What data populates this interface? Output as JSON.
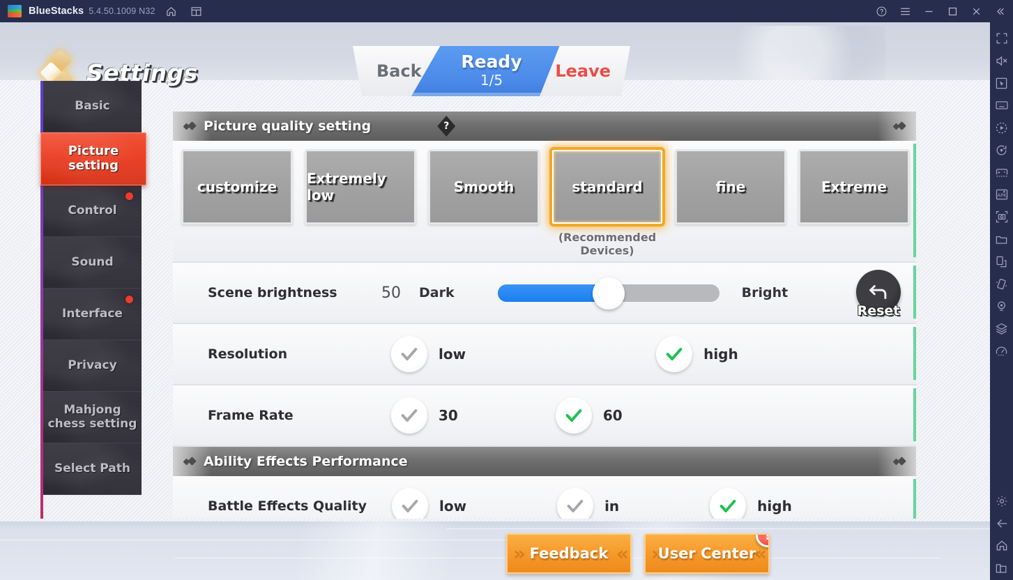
{
  "titlebar": {
    "brand": "BlueStacks",
    "version": "5.4.50.1009 N32",
    "icons": [
      "home-icon",
      "multi-instance-icon"
    ],
    "window_icons": [
      "help-icon",
      "menu-icon",
      "minimize-icon",
      "maximize-icon",
      "close-icon",
      "collapse-icon"
    ]
  },
  "sidebar": {
    "icons": [
      "fullscreen-icon",
      "mute-icon",
      "pointer-icon",
      "keyboard-icon",
      "macro-icon",
      "rotate-icon",
      "gamepad-icon",
      "install-apk-icon",
      "screenshot-icon",
      "media-folder-icon",
      "multi-instance-icon",
      "shake-icon",
      "location-icon",
      "layers-icon",
      "performance-icon"
    ],
    "bottom_icons": [
      "settings-gear-icon",
      "back-icon",
      "home-icon",
      "recents-icon"
    ]
  },
  "game": {
    "header": {
      "title": "Settings",
      "logo": "diamond-cluster-icon"
    },
    "status_bar": {
      "back_label": "Back",
      "ready_label": "Ready",
      "ready_count": "1/5",
      "leave_label": "Leave",
      "accent_color": "#4b8ae8"
    },
    "nav": {
      "items": [
        {
          "label": "Basic",
          "active": false,
          "dot": false
        },
        {
          "label": "Picture setting",
          "active": true,
          "dot": false
        },
        {
          "label": "Control",
          "active": false,
          "dot": true
        },
        {
          "label": "Sound",
          "active": false,
          "dot": false
        },
        {
          "label": "Interface",
          "active": false,
          "dot": true
        },
        {
          "label": "Privacy",
          "active": false,
          "dot": false
        },
        {
          "label": "Mahjong chess setting",
          "active": false,
          "dot": false
        },
        {
          "label": "Select Path",
          "active": false,
          "dot": false
        }
      ]
    },
    "sections": {
      "picture_quality": {
        "title": "Picture quality setting",
        "help": "?",
        "presets": [
          {
            "label": "customize",
            "selected": false
          },
          {
            "label": "Extremely low",
            "selected": false
          },
          {
            "label": "Smooth",
            "selected": false
          },
          {
            "label": "standard",
            "selected": true,
            "sub": "(Recommended\nDevices)"
          },
          {
            "label": "fine",
            "selected": false
          },
          {
            "label": "Extreme",
            "selected": false
          }
        ],
        "brightness": {
          "label": "Scene brightness",
          "value": "50",
          "min_label": "Dark",
          "max_label": "Bright",
          "percent": 50,
          "reset_label": "Reset",
          "reset_icon": "undo-arrow-icon",
          "fill_color": "#1a7ff0"
        },
        "resolution": {
          "label": "Resolution",
          "options": [
            {
              "label": "low",
              "checked": false
            },
            {
              "label": "high",
              "checked": true
            }
          ]
        },
        "frame_rate": {
          "label": "Frame Rate",
          "options": [
            {
              "label": "30",
              "checked": false
            },
            {
              "label": "60",
              "checked": true
            }
          ]
        }
      },
      "ability_effects": {
        "title": "Ability Effects Performance",
        "battle_effects": {
          "label": "Battle Effects Quality",
          "options": [
            {
              "label": "low",
              "checked": false
            },
            {
              "label": "in",
              "checked": false
            },
            {
              "label": "high",
              "checked": true
            }
          ]
        }
      }
    },
    "footer": {
      "feedback_label": "Feedback",
      "user_center_label": "User Center",
      "user_center_badge": "!"
    }
  }
}
